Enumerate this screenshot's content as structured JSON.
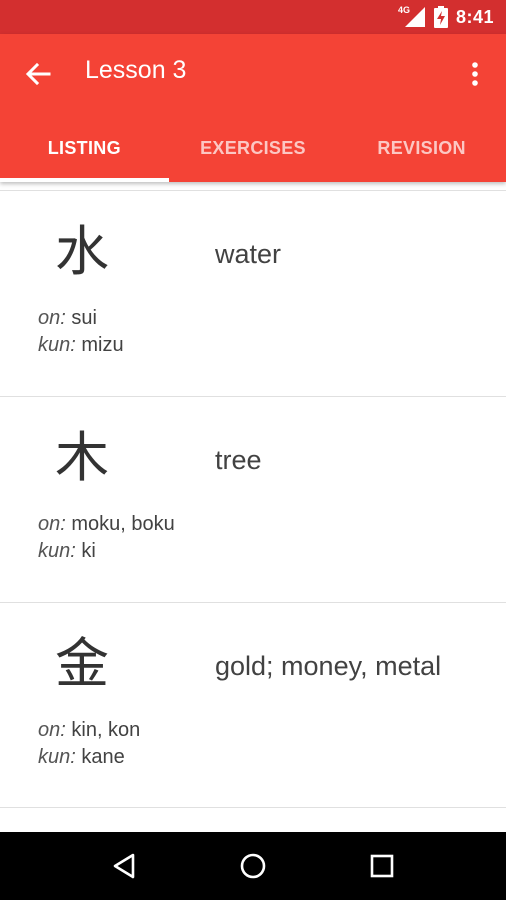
{
  "status_bar": {
    "network": "4G",
    "time": "8:41"
  },
  "toolbar": {
    "title": "Lesson 3",
    "back_icon": "arrow-left-icon",
    "menu_icon": "more-vert-icon"
  },
  "tabs": [
    {
      "label": "LISTING",
      "active": true
    },
    {
      "label": "EXERCISES",
      "active": false
    },
    {
      "label": "REVISION",
      "active": false
    }
  ],
  "kanji_list": [
    {
      "kanji": "水",
      "meaning": "water",
      "on_label": "on:",
      "on": "sui",
      "kun_label": "kun:",
      "kun": "mizu"
    },
    {
      "kanji": "木",
      "meaning": "tree",
      "on_label": "on:",
      "on": "moku, boku",
      "kun_label": "kun:",
      "kun": "ki"
    },
    {
      "kanji": "金",
      "meaning": "gold; money, metal",
      "on_label": "on:",
      "on": "kin, kon",
      "kun_label": "kun:",
      "kun": "kane"
    }
  ],
  "colors": {
    "status_bar": "#d32f2f",
    "app_bar": "#f44336",
    "text_primary": "#424242"
  }
}
